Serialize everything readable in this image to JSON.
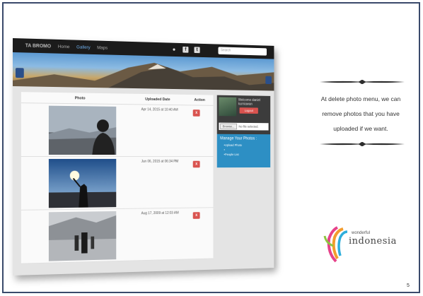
{
  "slide": {
    "caption": "At delete photo menu, we can remove photos that you have uploaded if we want.",
    "page_number": "5",
    "logo_small": "wonderful",
    "logo_main": "indonesia"
  },
  "app": {
    "brand": "TA BROMO",
    "nav": [
      "Home",
      "Gallery",
      "Maps"
    ],
    "active_nav": "Gallery",
    "search_placeholder": "Search"
  },
  "table": {
    "headers": [
      "Photo",
      "Uploaded Date",
      "Action"
    ],
    "rows": [
      {
        "date": "Apr 14, 2015 at 10:40 AM",
        "action": "x"
      },
      {
        "date": "Jun 06, 2015 at 06:34 PM",
        "action": "x"
      },
      {
        "date": "Aug 17, 2009 at 12:03 AM",
        "action": "x"
      }
    ]
  },
  "sidebar": {
    "welcome": "Welcome daniel kurniawan",
    "logout": "Logout",
    "browse": "Browse...",
    "file_status": "No file selected.",
    "manage_title": "Manage Your Photos :",
    "manage_items": [
      "Upload Photo",
      "",
      "People List"
    ]
  },
  "colors": {
    "delete_button": "#d9534f",
    "manage_panel": "#2d8fc4",
    "navbar": "#1b1b1b",
    "frame_border": "#3a4a6b"
  }
}
